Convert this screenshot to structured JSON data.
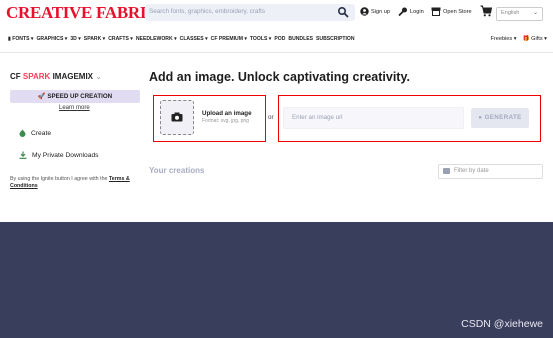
{
  "header": {
    "logo_text": "CREATIVE FABRICA",
    "search_placeholder": "Search fonts, graphics, embroidery, crafts",
    "sign_up": "Sign up",
    "login": "Login",
    "open_store": "Open Store",
    "language": "English"
  },
  "category_nav": {
    "items": [
      "FONTS ▾",
      "GRAPHICS ▾",
      "3D ▾",
      "SPARK ▾",
      "CRAFTS ▾",
      "NEEDLEWORK ▾",
      "CLASSES ▾",
      "CF PREMIUM ▾",
      "TOOLS ▾",
      "POD",
      "BUNDLES",
      "SUBSCRIPTION"
    ],
    "freebies": "Freebies ▾",
    "gifts": "Gifts ▾"
  },
  "sidebar": {
    "brand_cf": "CF",
    "brand_spark": "SPARK",
    "brand_imagemix": "IMAGEMIX",
    "speed_up": "SPEED UP CREATION",
    "learn_more": "Learn more",
    "create": "Create",
    "downloads": "My Private Downloads",
    "terms_prefix": "By using the Ignite button I agree with the",
    "terms_link": "Terms & Conditions"
  },
  "main": {
    "title": "Add an image. Unlock captivating creativity.",
    "upload_title": "Upload an image",
    "upload_formats": "Format: svg, jpg, png",
    "or": "or",
    "url_placeholder": "Enter an image url",
    "generate": "GENERATE",
    "your_creations": "Your creations",
    "filter_placeholder": "Filter by date"
  },
  "watermark": "CSDN @xiehewe",
  "colors": {
    "brand_red": "#e8112d",
    "accent_lavender": "#e2dcf2",
    "footer_bg": "#393e5d",
    "highlight_red": "#e00000"
  },
  "icons": [
    "search-icon",
    "user-icon",
    "login-icon",
    "store-icon",
    "cart-icon",
    "camera-icon",
    "create-icon",
    "download-icon",
    "rocket-icon",
    "calendar-icon",
    "gift-icon"
  ]
}
